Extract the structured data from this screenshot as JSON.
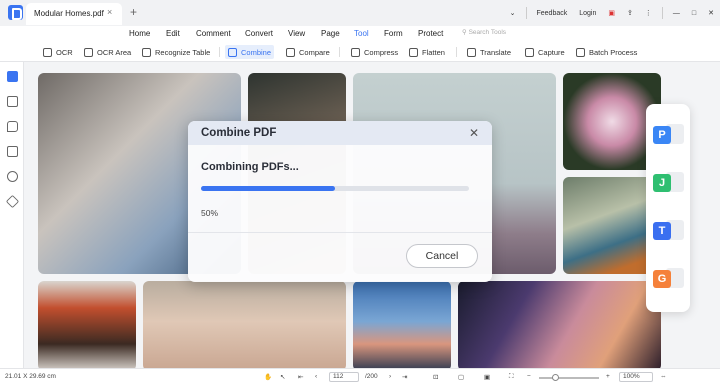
{
  "titlebar": {
    "tab_title": "Modular Homes.pdf",
    "tab_close": "×",
    "tab_add": "+",
    "feedback": "Feedback",
    "login": "Login"
  },
  "menu": [
    "Home",
    "Edit",
    "Comment",
    "Convert",
    "View",
    "Page",
    "Tool",
    "Form",
    "Protect"
  ],
  "menu_active": "Tool",
  "search_placeholder": "Search Tools",
  "tools": [
    "OCR",
    "OCR Area",
    "Recognize Table",
    "Combine",
    "Compare",
    "Compress",
    "Flatten",
    "Translate",
    "Capture",
    "Batch Process"
  ],
  "tool_active": "Combine",
  "dialog": {
    "title": "Combine PDF",
    "message": "Combining PDFs...",
    "progress": 0.5,
    "progress_text": "50%",
    "cancel_label": "Cancel"
  },
  "formats": [
    {
      "letter": "P",
      "color": "#3a86f5"
    },
    {
      "letter": "J",
      "color": "#2fbf71"
    },
    {
      "letter": "T",
      "color": "#3a6ff0"
    },
    {
      "letter": "G",
      "color": "#f5813a"
    }
  ],
  "statusbar": {
    "dimensions": "21.01 X 29.69 cm",
    "page_current": "112",
    "page_total": "/200",
    "zoom": "100%"
  },
  "colors": {
    "accent": "#3a74f1"
  }
}
